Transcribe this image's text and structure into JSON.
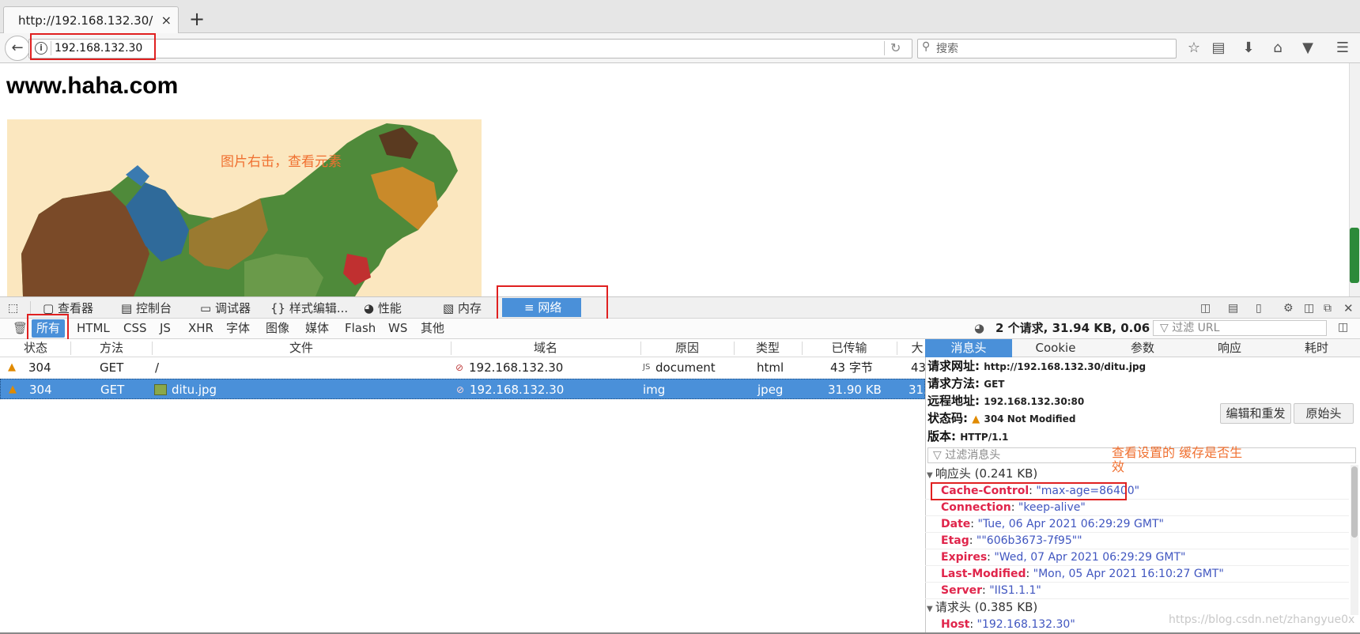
{
  "browser": {
    "tab_title": "http://192.168.132.30/",
    "tab_close": "×",
    "new_tab": "+",
    "url": "192.168.132.30",
    "search_placeholder": "搜索"
  },
  "page": {
    "title": "www.haha.com",
    "image_annotation": "图片右击，查看元素"
  },
  "devtools": {
    "tabs": [
      {
        "label": "查看器",
        "icon": "inspector-icon"
      },
      {
        "label": "控制台",
        "icon": "console-icon"
      },
      {
        "label": "调试器",
        "icon": "debugger-icon"
      },
      {
        "label": "样式编辑...",
        "icon": "style-editor-icon"
      },
      {
        "label": "性能",
        "icon": "performance-icon"
      },
      {
        "label": "内存",
        "icon": "memory-icon"
      },
      {
        "label": "网络",
        "icon": "network-icon"
      }
    ],
    "filters": [
      "所有",
      "HTML",
      "CSS",
      "JS",
      "XHR",
      "字体",
      "图像",
      "媒体",
      "Flash",
      "WS",
      "其他"
    ],
    "summary": "2 个请求, 31.94 KB, 0.06 秒",
    "url_filter_placeholder": "过滤 URL",
    "columns": [
      "状态",
      "方法",
      "文件",
      "域名",
      "原因",
      "类型",
      "已传输",
      "大"
    ],
    "rows": [
      {
        "status": "304",
        "method": "GET",
        "file": "/",
        "domain": "192.168.132.30",
        "cause": "document",
        "type": "html",
        "transferred": "43 字节",
        "size": "43"
      },
      {
        "status": "304",
        "method": "GET",
        "file": "ditu.jpg",
        "domain": "192.168.132.30",
        "cause": "img",
        "type": "jpeg",
        "transferred": "31.90 KB",
        "size": "31."
      }
    ]
  },
  "panel": {
    "tabs": [
      "消息头",
      "Cookie",
      "参数",
      "响应",
      "耗时"
    ],
    "request_url_label": "请求网址:",
    "request_url": "http://192.168.132.30/ditu.jpg",
    "method_label": "请求方法:",
    "method": "GET",
    "remote_label": "远程地址:",
    "remote": "192.168.132.30:80",
    "status_label": "状态码:",
    "status": "304  Not  Modified",
    "version_label": "版本:",
    "version": "HTTP/1.1",
    "edit_resend": "编辑和重发",
    "raw_headers": "原始头",
    "header_filter_placeholder": "过滤消息头",
    "annotation": "查看设置的  缓存是否生效",
    "response_section": "响应头",
    "response_size": "(0.241 KB)",
    "response_headers": [
      {
        "key": "Cache-Control",
        "value": "\"max-age=86400\""
      },
      {
        "key": "Connection",
        "value": "\"keep-alive\""
      },
      {
        "key": "Date",
        "value": "\"Tue, 06 Apr 2021 06:29:29 GMT\""
      },
      {
        "key": "Etag",
        "value": "\"\"606b3673-7f95\"\""
      },
      {
        "key": "Expires",
        "value": "\"Wed, 07 Apr 2021 06:29:29 GMT\""
      },
      {
        "key": "Last-Modified",
        "value": "\"Mon, 05 Apr 2021 16:10:27 GMT\""
      },
      {
        "key": "Server",
        "value": "\"IIS1.1.1\""
      }
    ],
    "request_section": "请求头",
    "request_size": "(0.385 KB)",
    "request_headers": [
      {
        "key": "Host",
        "value": "\"192.168.132.30\""
      }
    ]
  },
  "watermark": "https://blog.csdn.net/zhangyue0x"
}
